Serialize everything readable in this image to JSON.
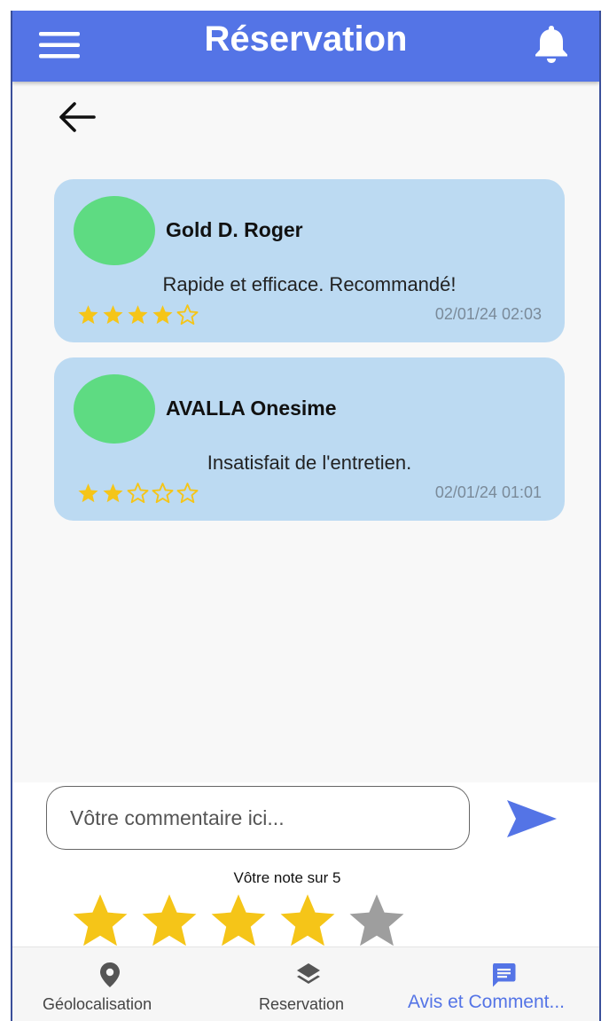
{
  "header": {
    "title": "Réservation",
    "menu_icon": "hamburger-menu-icon",
    "bell_icon": "bell-icon",
    "back_icon": "arrow-left-icon"
  },
  "reviews": [
    {
      "name": "Gold D. Roger",
      "text": "Rapide et efficace. Recommandé!",
      "date": "02/01/24 02:03",
      "rating": 4,
      "max_rating": 5
    },
    {
      "name": "AVALLA Onesime",
      "text": "Insatisfait de l'entretien.",
      "date": "02/01/24 01:01",
      "rating": 2,
      "max_rating": 5
    }
  ],
  "comment": {
    "placeholder": "Vôtre commentaire ici...",
    "value": "",
    "send_icon": "send-icon"
  },
  "rating_input": {
    "label": "Vôtre note sur 5",
    "value": 4,
    "max": 5
  },
  "bottom_nav": {
    "items": [
      {
        "label": "Géolocalisation",
        "icon": "location-pin-icon",
        "active": false
      },
      {
        "label": "Reservation",
        "icon": "layers-icon",
        "active": false
      },
      {
        "label": "Avis et Comment...",
        "icon": "comment-icon",
        "active": true
      }
    ]
  },
  "colors": {
    "app_bar": "#5474e6",
    "accent": "#5474e6",
    "card_background": "#bcdaf2",
    "avatar": "#5edb82",
    "star_filled": "#f5c518",
    "star_empty": "#9e9e9e",
    "nav_inactive": "#444444"
  }
}
